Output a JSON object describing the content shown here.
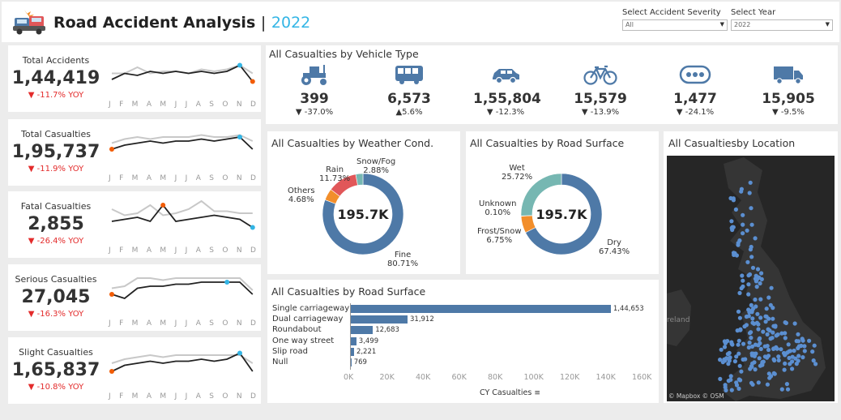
{
  "header": {
    "title": "Road Accident Analysis",
    "separator": "|",
    "year": "2022",
    "filters": [
      {
        "label": "Select Accident Severity",
        "value": "All"
      },
      {
        "label": "Select Year",
        "value": "2022"
      }
    ]
  },
  "kpis": [
    {
      "title": "Total Accidents",
      "value": "1,44,419",
      "yoy": "▼ -11.7% YOY"
    },
    {
      "title": "Total Casualties",
      "value": "1,95,737",
      "yoy": "▼ -11.9% YOY"
    },
    {
      "title": "Fatal Casualties",
      "value": "2,855",
      "yoy": "▼ -26.4% YOY"
    },
    {
      "title": "Serious  Casualties",
      "value": "27,045",
      "yoy": "▼ -16.3% YOY"
    },
    {
      "title": "Slight Casualties",
      "value": "1,65,837",
      "yoy": "▼ -10.8% YOY"
    }
  ],
  "months": [
    "J",
    "F",
    "M",
    "A",
    "M",
    "J",
    "J",
    "A",
    "S",
    "O",
    "N",
    "D"
  ],
  "vehicle": {
    "title": "All Casualties by Vehicle Type",
    "items": [
      {
        "icon": "tractor-icon",
        "value": "399",
        "change": "▼ -37.0%"
      },
      {
        "icon": "bus-icon",
        "value": "6,573",
        "change": "▲5.6%"
      },
      {
        "icon": "car-icon",
        "value": "1,55,804",
        "change": "▼ -12.3%"
      },
      {
        "icon": "bicycle-icon",
        "value": "15,579",
        "change": "▼ -13.9%"
      },
      {
        "icon": "other-vehicle-icon",
        "value": "1,477",
        "change": "▼ -24.1%"
      },
      {
        "icon": "truck-icon",
        "value": "15,905",
        "change": "▼ -9.5%"
      }
    ]
  },
  "weather": {
    "title": "All Casualties by Weather Cond.",
    "center": "195.7K",
    "labels": {
      "snow_name": "Snow/Fog",
      "snow_pct": "2.88%",
      "rain_name": "Rain",
      "rain_pct": "11.73%",
      "others_name": "Others",
      "others_pct": "4.68%",
      "fine_name": "Fine",
      "fine_pct": "80.71%"
    }
  },
  "surface": {
    "title": "All Casualties by Road Surface",
    "center": "195.7K",
    "labels": {
      "wet_name": "Wet",
      "wet_pct": "25.72%",
      "unknown_name": "Unknown",
      "unknown_pct": "0.10%",
      "frost_name": "Frost/Snow",
      "frost_pct": "6.75%",
      "dry_name": "Dry",
      "dry_pct": "67.43%"
    }
  },
  "road": {
    "title": "All Casualties by Road Surface",
    "xlabel": "CY Casualties",
    "sort_icon": "sort-icon",
    "ticks": [
      "0K",
      "20K",
      "40K",
      "60K",
      "80K",
      "100K",
      "120K",
      "140K",
      "160K"
    ]
  },
  "location": {
    "title": "All Casualtiesby Location",
    "sea_label": "reland",
    "credit": "© Mapbox © OSM"
  },
  "colors": {
    "blue": "#4e79a7",
    "orange": "#f28e2b",
    "red": "#e15759",
    "teal": "#76b7b2",
    "accent": "#33b5e5",
    "spark_line": "#222222",
    "spark_prev": "#c8c8c8",
    "map_bg": "#262626",
    "land": "#353535"
  },
  "chart_data": [
    {
      "type": "pie",
      "title": "All Casualties by Weather Cond.",
      "categories": [
        "Fine",
        "Others",
        "Rain",
        "Snow/Fog"
      ],
      "values": [
        80.71,
        4.68,
        11.73,
        2.88
      ]
    },
    {
      "type": "pie",
      "title": "All Casualties by Road Surface",
      "categories": [
        "Dry",
        "Frost/Snow",
        "Unknown",
        "Wet"
      ],
      "values": [
        67.43,
        6.75,
        0.1,
        25.72
      ]
    },
    {
      "type": "bar",
      "title": "All Casualties by Road Surface",
      "categories": [
        "Single carriageway",
        "Dual carriageway",
        "Roundabout",
        "One way street",
        "Slip road",
        "Null"
      ],
      "values": [
        144653,
        31912,
        12683,
        3499,
        2221,
        769
      ],
      "data_labels": [
        "1,44,653",
        "31,912",
        "12,683",
        "3,499",
        "2,221",
        "769"
      ],
      "xlabel": "CY Casualties",
      "xlim": [
        0,
        160000
      ]
    }
  ]
}
